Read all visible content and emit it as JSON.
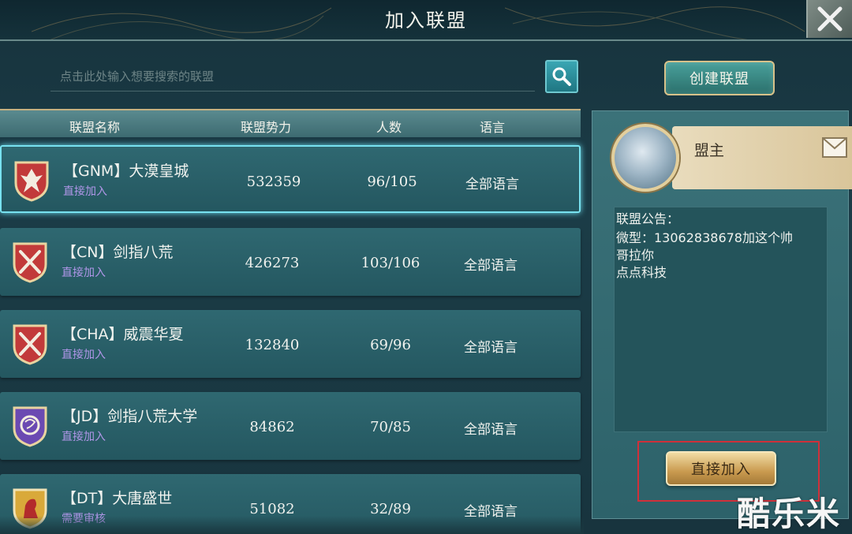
{
  "header": {
    "title": "加入联盟"
  },
  "search": {
    "placeholder": "点击此处输入想要搜索的联盟"
  },
  "create_button": "创建联盟",
  "columns": {
    "name": "联盟名称",
    "power": "联盟势力",
    "members": "人数",
    "language": "语言"
  },
  "alliances": [
    {
      "name": "【GNM】大漠皇城",
      "join": "直接加入",
      "power": "532359",
      "members": "96/105",
      "language": "全部语言",
      "emblem": "phoenix-icon",
      "color": "#c23a3a",
      "selected": true
    },
    {
      "name": "【CN】剑指八荒",
      "join": "直接加入",
      "power": "426273",
      "members": "103/106",
      "language": "全部语言",
      "emblem": "swords-icon",
      "color": "#c23a3a",
      "selected": false
    },
    {
      "name": "【CHA】威震华夏",
      "join": "直接加入",
      "power": "132840",
      "members": "69/96",
      "language": "全部语言",
      "emblem": "swords-icon",
      "color": "#c23a3a",
      "selected": false
    },
    {
      "name": "【JD】剑指八荒大学",
      "join": "直接加入",
      "power": "84862",
      "members": "70/85",
      "language": "全部语言",
      "emblem": "dragon-icon",
      "color": "#6b4ab2",
      "selected": false
    },
    {
      "name": "【DT】大唐盛世",
      "join": "需要审核",
      "power": "51082",
      "members": "32/89",
      "language": "全部语言",
      "emblem": "lion-icon",
      "color": "#d9a93a",
      "selected": false
    }
  ],
  "detail": {
    "leader_label": "盟主",
    "notice_lines": [
      "联盟公告：",
      "微型：13062838678加这个帅",
      "哥拉你",
      "点点科技"
    ],
    "join_button": "直接加入"
  },
  "watermark": "酷乐米"
}
